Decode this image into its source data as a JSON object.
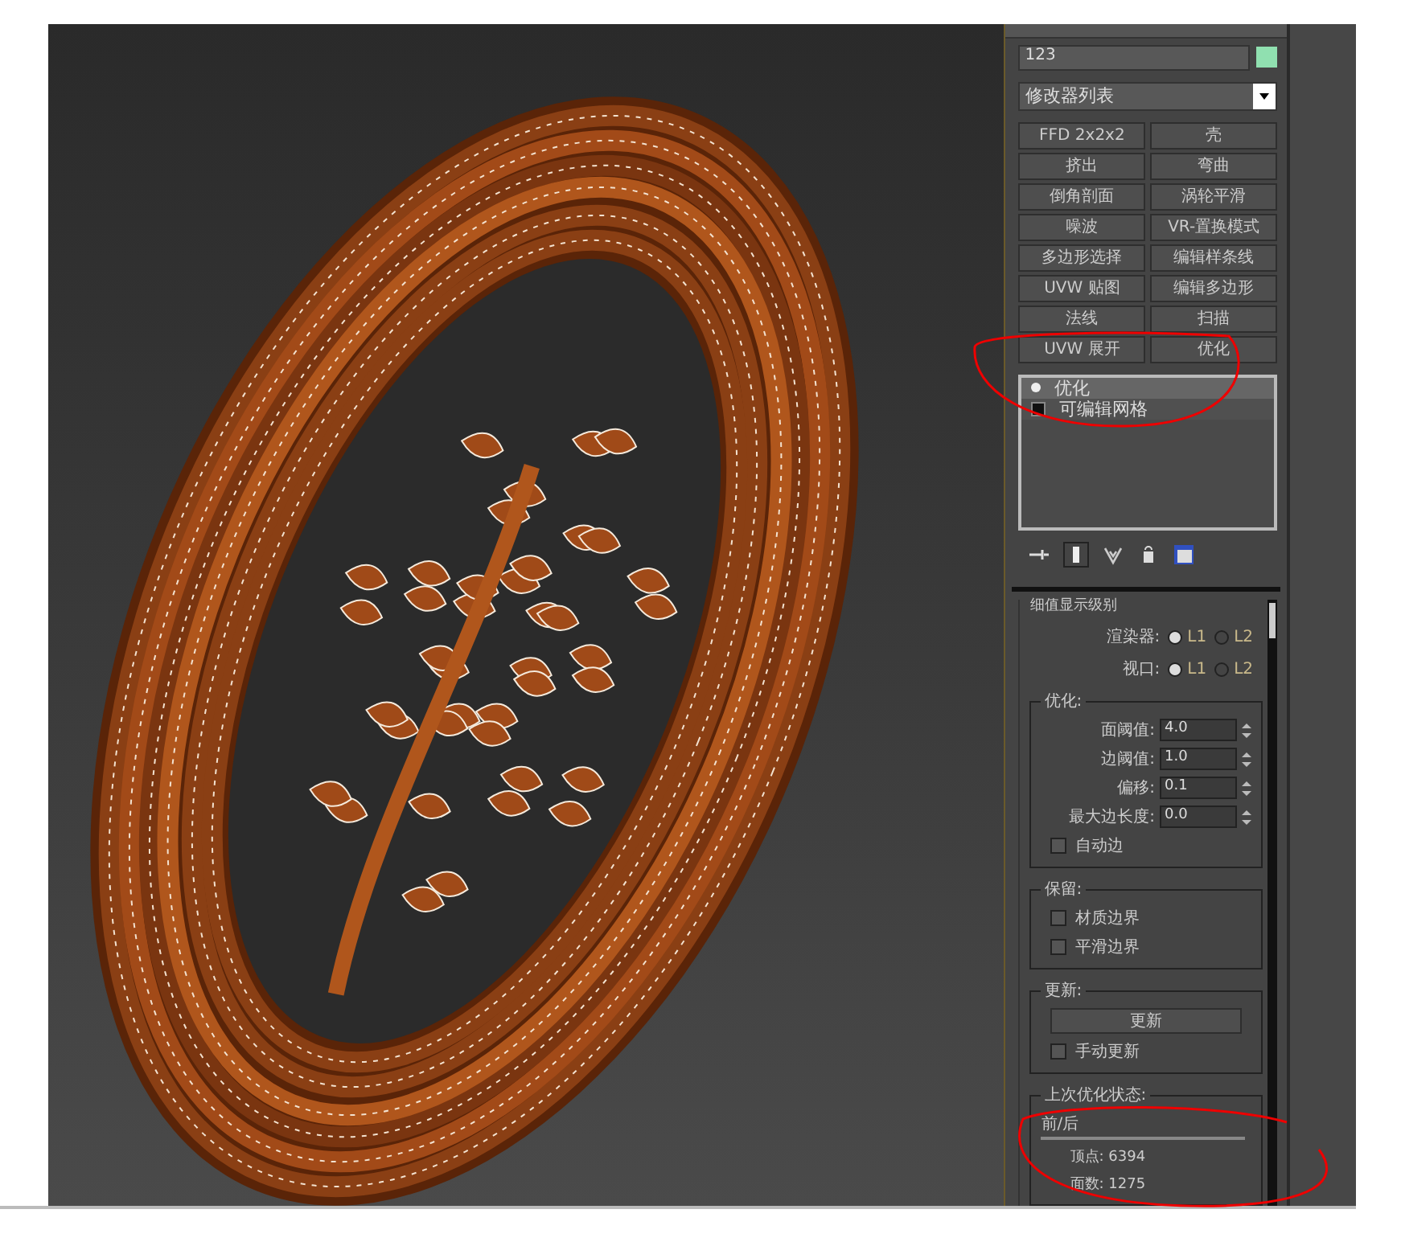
{
  "object_name": "123",
  "modifier_list": "修改器列表",
  "modifier_buttons": [
    "FFD 2x2x2",
    "壳",
    "挤出",
    "弯曲",
    "倒角剖面",
    "涡轮平滑",
    "噪波",
    "VR-置换模式",
    "多边形选择",
    "编辑样条线",
    "UVW 贴图",
    "编辑多边形",
    "法线",
    "扫描",
    "UVW 展开",
    "优化"
  ],
  "stack": [
    {
      "label": "优化",
      "kind": "modifier",
      "selected": true
    },
    {
      "label": "可编辑网格",
      "kind": "base",
      "selected": false
    }
  ],
  "rollout_title": "细值显示级别",
  "display_levels": [
    {
      "label": "渲染器:",
      "options": [
        {
          "label": "L1",
          "selected": true
        },
        {
          "label": "L2",
          "selected": false
        }
      ]
    },
    {
      "label": "视口:",
      "options": [
        {
          "label": "L1",
          "selected": true
        },
        {
          "label": "L2",
          "selected": false
        }
      ]
    }
  ],
  "groups": [
    {
      "title": "优化:",
      "items": [
        {
          "kind": "spinner",
          "label": "面阈值:",
          "value": "4.0"
        },
        {
          "kind": "spinner",
          "label": "边阈值:",
          "value": "1.0"
        },
        {
          "kind": "spinner",
          "label": "偏移:",
          "value": "0.1"
        },
        {
          "kind": "spinner",
          "label": "最大边长度:",
          "value": "0.0"
        },
        {
          "kind": "checkbox",
          "label": "自动边",
          "checked": false
        }
      ]
    },
    {
      "title": "保留:",
      "items": [
        {
          "kind": "checkbox",
          "label": "材质边界",
          "checked": false
        },
        {
          "kind": "checkbox",
          "label": "平滑边界",
          "checked": false
        }
      ]
    },
    {
      "title": "更新:",
      "items": [
        {
          "kind": "button",
          "label": "更新"
        },
        {
          "kind": "checkbox",
          "label": "手动更新",
          "checked": false
        }
      ]
    },
    {
      "title": "上次优化状态:",
      "items": [
        {
          "kind": "heading",
          "label": "前/后"
        },
        {
          "kind": "stat",
          "label": "顶点: 6394"
        },
        {
          "kind": "stat",
          "label": "面数: 1275"
        }
      ]
    }
  ]
}
